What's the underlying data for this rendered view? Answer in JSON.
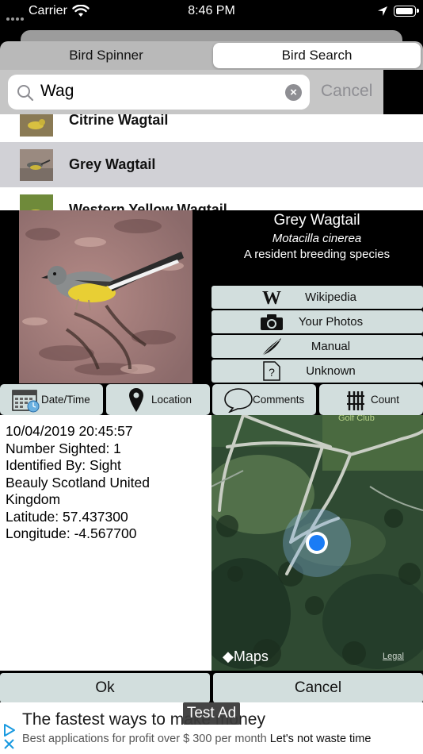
{
  "status_bar": {
    "carrier": "Carrier",
    "time": "8:46 PM"
  },
  "segments": {
    "left": "Bird Spinner",
    "right": "Bird Search",
    "selected": "Bird Search"
  },
  "search": {
    "value": "Wag",
    "cancel_label": "Cancel"
  },
  "results": [
    {
      "name": "Citrine Wagtail"
    },
    {
      "name": "Grey Wagtail"
    },
    {
      "name": "Western Yellow Wagtail"
    }
  ],
  "bird": {
    "common_name": "Grey Wagtail",
    "latin_name": "Motacilla cinerea",
    "status": "A resident breeding species"
  },
  "links": {
    "wikipedia": "Wikipedia",
    "your_photos": "Your Photos",
    "manual": "Manual",
    "unknown": "Unknown"
  },
  "tabs": {
    "date_time": "Date/Time",
    "location": "Location",
    "comments": "Comments",
    "count": "Count"
  },
  "info": {
    "datetime": "10/04/2019 20:45:57",
    "number_sighted": "Number Sighted: 1",
    "identified_by": "Identified By: Sight",
    "place_line1": "Beauly Scotland United",
    "place_line2": "Kingdom",
    "latitude": "Latitude: 57.437300",
    "longitude": "Longitude: -4.567700"
  },
  "map": {
    "logo_text": "Maps",
    "legal": "Legal",
    "place_label": "Golf Club"
  },
  "buttons": {
    "ok": "Ok",
    "cancel": "Cancel"
  },
  "ad": {
    "title": "The fastest ways to make money",
    "subtitle_prefix": "Best applications for profit over $ 300 per month",
    "subtitle_suffix": "Let's not waste time",
    "test_label": "Test Ad"
  },
  "colors": {
    "button_bg": "#d2dedd",
    "selected_row": "#d1d1d6",
    "location_dot": "#1a7cf5"
  }
}
